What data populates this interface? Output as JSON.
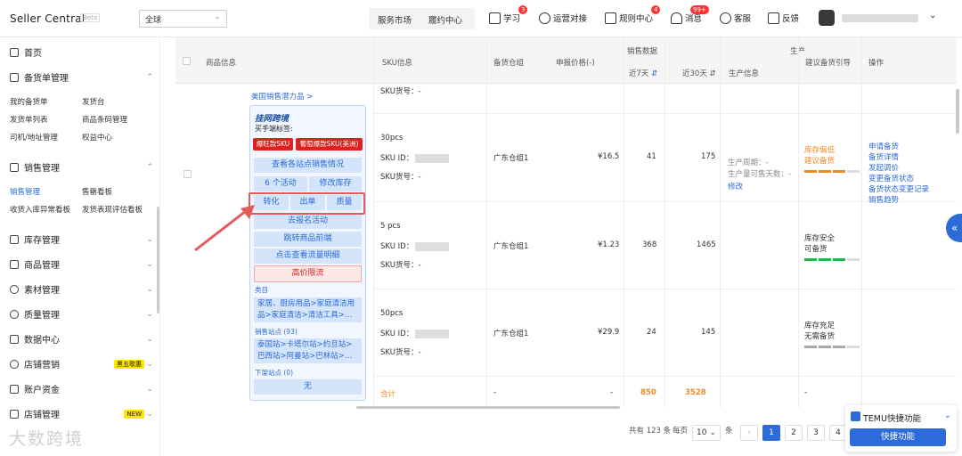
{
  "header": {
    "brand": "Seller Central",
    "beta": "Beta",
    "region": "全球",
    "tabs": [
      "服务市场",
      "履约中心"
    ],
    "nav": [
      {
        "label": "学习",
        "badge": "3"
      },
      {
        "label": "运营对接",
        "badge": ""
      },
      {
        "label": "规则中心",
        "badge": "4"
      },
      {
        "label": "消息",
        "badge": "99+"
      },
      {
        "label": "客服",
        "badge": ""
      },
      {
        "label": "反馈",
        "badge": ""
      }
    ]
  },
  "sidebar": {
    "home": "首页",
    "stock_mgmt": "备货单管理",
    "stock_subs": [
      "我的备货单",
      "发货台",
      "发货单列表",
      "商品条码管理",
      "司机/地址管理",
      "权益中心"
    ],
    "sales_mgmt": "销售管理",
    "sales_subs": [
      "销售管理",
      "售罄看板",
      "收货入库异常看板",
      "发货表现评估看板"
    ],
    "menus": [
      "库存管理",
      "商品管理",
      "素材管理",
      "质量管理",
      "数据中心",
      "店铺营销",
      "账户资金",
      "店铺管理"
    ],
    "marketing_badge": "黑五歌惠",
    "new_badge": "NEW"
  },
  "table": {
    "headers": {
      "product": "商品信息",
      "sku": "SKU信息",
      "warehouse": "备货仓组",
      "price": "申报价格(-)",
      "sales": "销售数据",
      "d7": "近7天",
      "d30": "近30天",
      "production": "生产",
      "prod_info": "生产信息",
      "advice": "建议备货引导",
      "ops": "操作"
    },
    "sku_no_label": "SKU货号：-",
    "rows": [
      {
        "spec": "30pcs",
        "sku_label": "SKU ID：",
        "wh": "广东仓组1",
        "price": "¥16.5",
        "d7": "41",
        "d30": "175",
        "advice": "库存偏低\n建议备货"
      },
      {
        "spec": "5 pcs",
        "sku_label": "SKU ID：",
        "wh": "广东仓组1",
        "price": "¥1.23",
        "d7": "368",
        "d30": "1465",
        "advice": "库存安全\n可备货"
      },
      {
        "spec": "50pcs",
        "sku_label": "SKU ID：",
        "wh": "广东仓组1",
        "price": "¥29.9",
        "d7": "24",
        "d30": "145",
        "advice": "库存充足\n无需备货"
      }
    ],
    "prod_cycle": "生产周期：-",
    "prod_days": "生产量可售天数：-",
    "modify": "修改",
    "ops": [
      "申请备货",
      "备货详情",
      "发起调价",
      "变更备货状态",
      "备货状态变更记录",
      "销售趋势"
    ],
    "total": {
      "label": "合计",
      "wh": "-",
      "price": "-",
      "d7": "850",
      "d30": "3528",
      "advice": "-"
    }
  },
  "card": {
    "top_label": "美国销售潜力品 >",
    "brand": "挂网跨境",
    "buyer_tag": "买手端标签:",
    "red_tags": [
      "爆旺款SKU",
      "葡萄爆款SKU(美洲)"
    ],
    "view_sales": "查看各站点销售情况",
    "activities": "6 个活动",
    "edit_stock": "修改库存",
    "convert": "转化",
    "orders": "出单",
    "quality": "质量",
    "join_activity": "去报名活动",
    "jump_front": "跳转商品前端",
    "traffic": "点击查看流量明细",
    "high_price": "高价限流",
    "category_label": "类目",
    "category": "家居、厨房用品>家庭清洁用品>家庭清洁>清洁工具>…",
    "sites_label": "销售站点 (93)",
    "sites": "泰国站>卡塔尔站>约旦站>巴西站>阿曼站>巴林站>…",
    "offsale_label": "下架站点 (0)",
    "offsale": "无"
  },
  "pagination": {
    "total": "共有 123 条",
    "per_page": "每页",
    "size": "10",
    "unit": "条",
    "pages": [
      "1",
      "2",
      "3",
      "4"
    ]
  },
  "quick": {
    "title": "TEMU快捷功能",
    "button": "快捷功能"
  },
  "watermark": "大数跨境"
}
